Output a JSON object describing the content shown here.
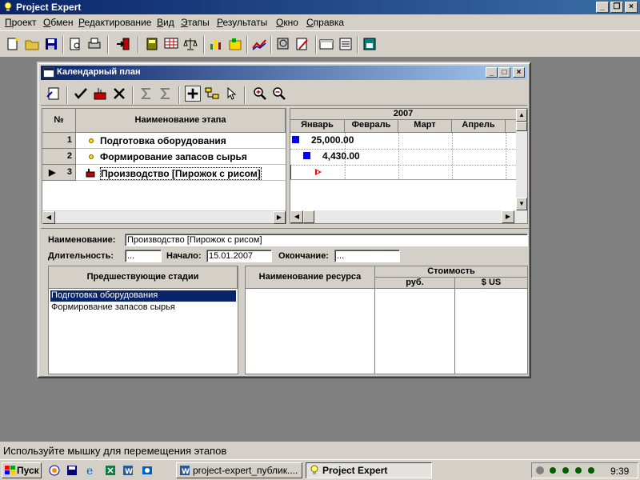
{
  "app": {
    "title": "Project Expert"
  },
  "menu": [
    "Проект",
    "Обмен",
    "Редактирование",
    "Вид",
    "Этапы",
    "Результаты",
    "Окно",
    "Справка"
  ],
  "window": {
    "title": "Календарный план"
  },
  "grid": {
    "col_num": "№",
    "col_name": "Наименование этапа",
    "rows": [
      {
        "num": "1",
        "name": "Подготовка оборудования"
      },
      {
        "num": "2",
        "name": "Формирование запасов сырья"
      },
      {
        "num": "3",
        "name": "Производство [Пирожок с рисом]"
      }
    ]
  },
  "gantt": {
    "year": "2007",
    "months": [
      "Январь",
      "Февраль",
      "Март",
      "Апрель"
    ],
    "bar_labels": [
      "25,000.00",
      "4,430.00"
    ]
  },
  "details": {
    "name_label": "Наименование:",
    "name_value": "Производство [Пирожок с рисом]",
    "duration_label": "Длительность:",
    "duration_value": "...",
    "start_label": "Начало:",
    "start_value": "15.01.2007",
    "end_label": "Окончание:",
    "end_value": "..."
  },
  "predecessors": {
    "header": "Предшествующие стадии",
    "items": [
      "Подготовка оборудования",
      "Формирование запасов сырья"
    ]
  },
  "resources": {
    "header": "Наименование ресурса",
    "cost_header": "Стоимость",
    "cost_rub": "руб.",
    "cost_usd": "$ US"
  },
  "status": {
    "text": "Используйте мышку для перемещения этапов"
  },
  "taskbar": {
    "start": "Пуск",
    "tasks": [
      "project-expert_публик....",
      "Project Expert"
    ],
    "clock": "9:39"
  },
  "colors": {
    "titlebar": "#0a246a",
    "selection": "#0a246a",
    "gantt_bar": "#0000ff",
    "milestone": "#ff0000"
  }
}
